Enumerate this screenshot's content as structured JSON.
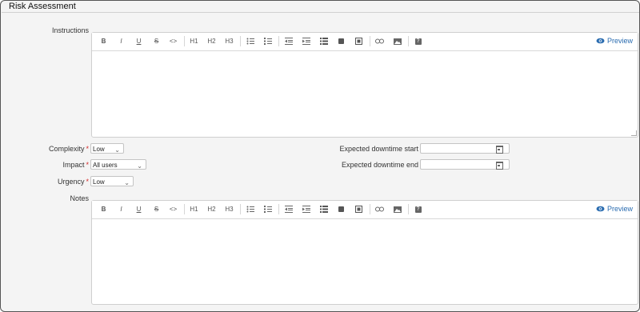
{
  "section": {
    "title": "Risk Assessment"
  },
  "instructions": {
    "label": "Instructions"
  },
  "notes": {
    "label": "Notes"
  },
  "toolbar": {
    "bold": "B",
    "italic": "I",
    "underline": "U",
    "strikethrough": "S",
    "code": "<>",
    "h1": "H1",
    "h2": "H2",
    "h3": "H3",
    "preview": "Preview"
  },
  "fields": {
    "complexity": {
      "label": "Complexity",
      "value": "Low"
    },
    "impact": {
      "label": "Impact",
      "value": "All users"
    },
    "urgency": {
      "label": "Urgency",
      "value": "Low"
    },
    "required_mark": "*",
    "downtime_start": {
      "label": "Expected downtime start",
      "value": ""
    },
    "downtime_end": {
      "label": "Expected downtime end",
      "value": ""
    }
  },
  "icons": {
    "bullet_list": "bullet-list-icon",
    "numbered_list": "numbered-list-icon",
    "outdent": "outdent-icon",
    "indent": "indent-icon",
    "list_block": "list-icon",
    "blockquote": "quote-icon",
    "embed": "embed-icon",
    "link": "link-icon",
    "image": "image-icon",
    "help": "help-icon",
    "preview": "eye-icon",
    "calendar": "calendar-icon"
  },
  "colors": {
    "accent": "#2a6cb0",
    "required": "#d42a2a"
  }
}
